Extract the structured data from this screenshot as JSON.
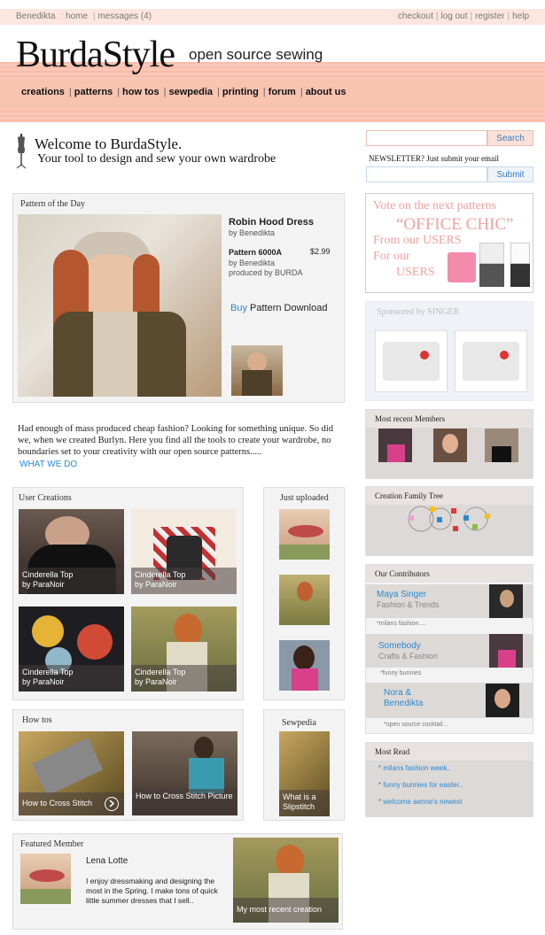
{
  "topbar": {
    "user": "Benedikta",
    "home": "home",
    "messages": "messages (4)",
    "checkout": "checkout",
    "logout": "log out",
    "register": "register",
    "help": "help"
  },
  "brand": {
    "logo": "BurdaStyle",
    "tagline": "open source sewing"
  },
  "nav": [
    "creations",
    "patterns",
    "how tos",
    "sewpedia",
    "printing",
    "forum",
    "about us"
  ],
  "welcome": {
    "title": "Welcome to BurdaStyle.",
    "subtitle": "Your tool to design and sew your own wardrobe"
  },
  "pattern_of_day": {
    "label": "Pattern of the Day",
    "name": "Robin Hood Dress",
    "by": "by  Benedikta",
    "pattern": "Pattern 6000A",
    "price": "$2.99",
    "pattern_by": "by Benedikta",
    "produced": "produced by BURDA",
    "buy": "Buy",
    "download": "Pattern Download"
  },
  "intro": {
    "text": "Had enough of mass produced cheap fashion? Looking for something unique. So did we, when we created Burlyn. Here you find all the tools to create your wardrobe, no boundaries set to your creativity with our open source patterns.....",
    "link": "WHAT WE DO"
  },
  "user_creations": {
    "label": "User Creations",
    "items": [
      {
        "title": "Cinderella Top",
        "by": "by ParaNoir"
      },
      {
        "title": "Cinderella Top",
        "by": "by ParaNoir"
      },
      {
        "title": "Cinderella Top",
        "by": "by ParaNoir"
      },
      {
        "title": "Cinderella Top",
        "by": "by ParaNoir"
      }
    ]
  },
  "just_uploaded": {
    "label": "Just uploaded"
  },
  "howtos": {
    "label": "How tos",
    "items": [
      "How to Cross Stitch",
      "How to Cross Stitch Picture"
    ]
  },
  "sewpedia": {
    "label": "Sewpedia",
    "item": "What is a Slipstitch"
  },
  "featured": {
    "label": "Featured Member",
    "name": "Lena Lotte",
    "text": "I enjoy dressmaking and designing the most in the Spring. I make tons of quick little summer dresses that I sell..",
    "creation": "My most recent creation"
  },
  "sidebar": {
    "search_placeholder": "",
    "search_btn": "Search",
    "newsletter": "NEWSLETTER? Just submit your email",
    "submit_btn": "Submit",
    "vote": {
      "line1": "Vote on the next patterns",
      "line2": "“OFFICE CHIC”",
      "line3": "From our USERS",
      "line4": "For our",
      "line5": "USERS"
    },
    "sponsor": "Sponsored by SINGER",
    "recent_members": "Most recent Members",
    "family_tree": "Creation Family Tree",
    "contributors": {
      "label": "Our Contributors",
      "items": [
        {
          "name": "Maya Singer",
          "role": "Fashion & Trends",
          "note": "*milans fashion...."
        },
        {
          "name": "Somebody",
          "role": "Crafts & Fashion",
          "note": "*funny bunnies"
        },
        {
          "name": "Nora &",
          "name2": "Benedikta",
          "note": "*open source cocktail..."
        }
      ]
    },
    "most_read": {
      "label": "Most Read",
      "items": [
        "* milans fashion week..",
        "* funny bunnies for easter..",
        "* welcome aenne's newest"
      ]
    }
  }
}
